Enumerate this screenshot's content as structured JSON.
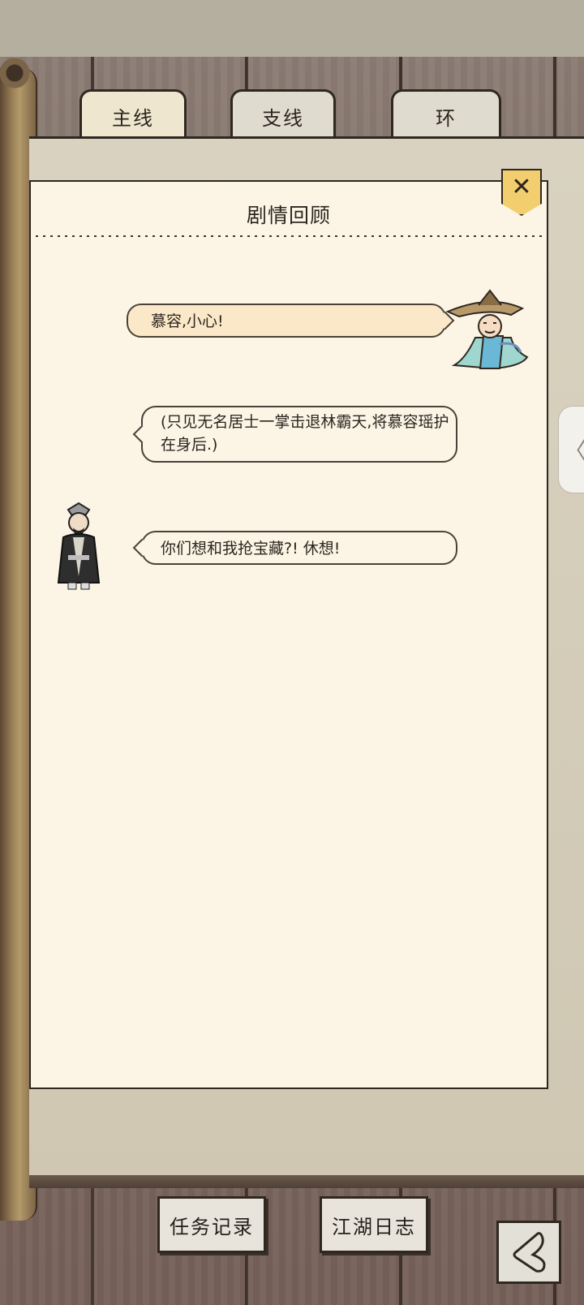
{
  "tabs": [
    {
      "label": "主线",
      "active": true
    },
    {
      "label": "支线",
      "active": false
    },
    {
      "label": "环",
      "active": false
    }
  ],
  "panel": {
    "title": "剧情回顾",
    "close_icon": "close-icon"
  },
  "dialogue": [
    {
      "speaker_side": "right",
      "speaker_icon": "straw-hat-swordsman-avatar",
      "text": "慕容,小心!"
    },
    {
      "speaker_side": "narration",
      "text": "(只见无名居士一掌击退林霸天,将慕容瑶护在身后.)"
    },
    {
      "speaker_side": "left",
      "speaker_icon": "black-robed-villain-avatar",
      "text": "你们想和我抢宝藏?! 休想!"
    }
  ],
  "bottom": {
    "task_log": "任务记录",
    "jianghu_journal": "江湖日志",
    "back_icon": "back-icon"
  },
  "side_handle_icon": "chevron-left-icon",
  "colors": {
    "panel_bg": "#fcf5e6",
    "bubble_highlight": "#fbe8c8",
    "close_btn": "#f3ce6e",
    "wood": "#7b6a62"
  }
}
